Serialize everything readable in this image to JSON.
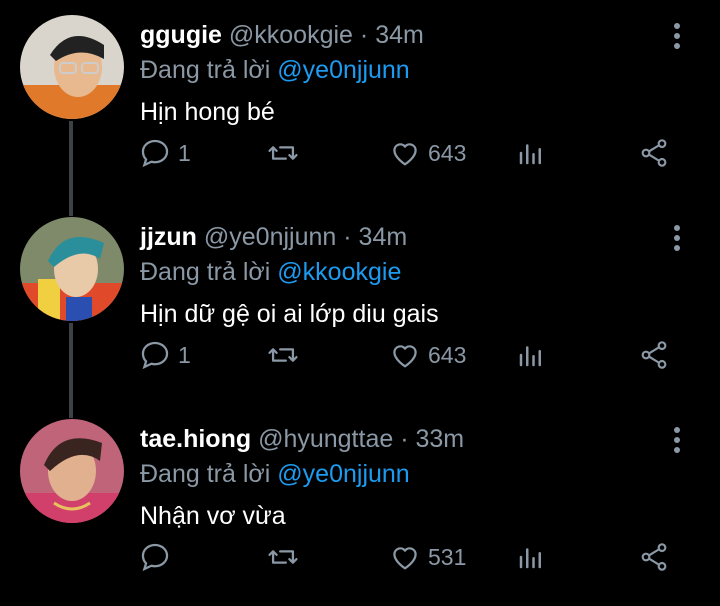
{
  "tweets": [
    {
      "name": "ggugie",
      "handle": "@kkookgie",
      "separator": "·",
      "time": "34m",
      "reply_prefix": "Đang trả lời",
      "reply_to": "@ye0njjunn",
      "text": "Hịn hong bé",
      "replies": "1",
      "likes": "643",
      "avatar_colors": [
        "#d9d4cc",
        "#222",
        "#e8b98f"
      ]
    },
    {
      "name": "jjzun",
      "handle": "@ye0njjunn",
      "separator": "·",
      "time": "34m",
      "reply_prefix": "Đang trả lời",
      "reply_to": "@kkookgie",
      "text": "Hịn dữ gệ oi ai lớp diu gais",
      "replies": "1",
      "likes": "643",
      "avatar_colors": [
        "#7e8a6a",
        "#2a8f9b",
        "#e8c9a8"
      ]
    },
    {
      "name": "tae.hiong",
      "handle": "@hyungttae",
      "separator": "·",
      "time": "33m",
      "reply_prefix": "Đang trả lời",
      "reply_to": "@ye0njjunn",
      "text": "Nhận vơ vừa",
      "replies": "",
      "likes": "531",
      "avatar_colors": [
        "#c0647a",
        "#3a2420",
        "#e0b08f"
      ]
    }
  ],
  "colors": {
    "background": "#000000",
    "text": "#ffffff",
    "secondary": "#8b98a5",
    "mention": "#1d9bf0",
    "thread_line": "#3d4144"
  },
  "icons": [
    "reply-icon",
    "retweet-icon",
    "like-icon",
    "stats-icon",
    "share-icon",
    "more-icon"
  ]
}
